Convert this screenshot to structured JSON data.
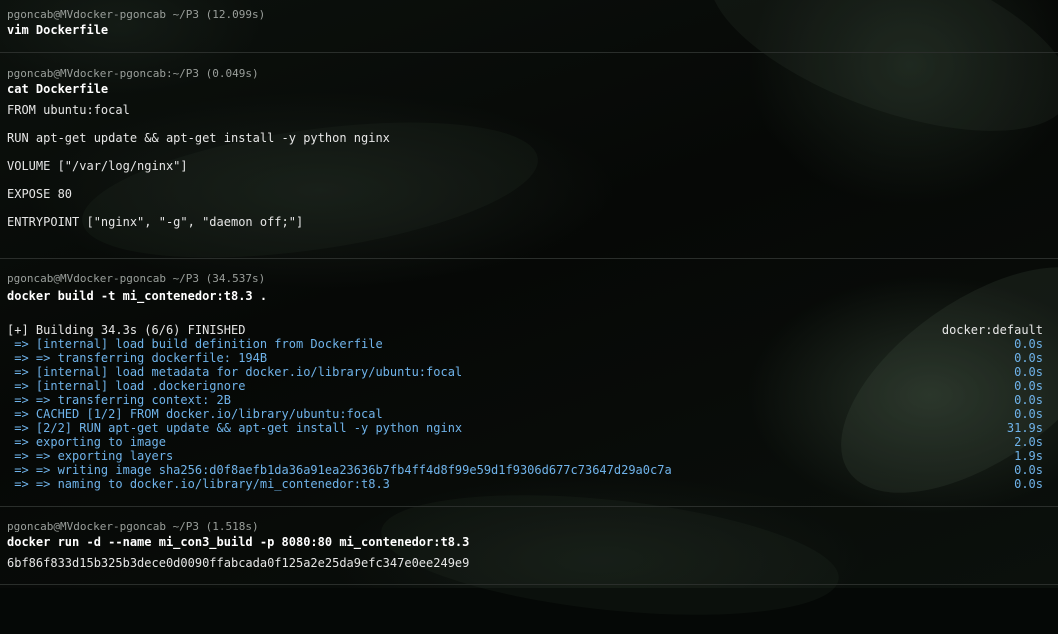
{
  "blocks": [
    {
      "prompt": "pgoncab@MVdocker-pgoncab ~/P3 (12.099s)",
      "command": "vim Dockerfile"
    },
    {
      "prompt": "pgoncab@MVdocker-pgoncab:~/P3 (0.049s)",
      "command": "cat Dockerfile",
      "output": [
        "FROM ubuntu:focal",
        "RUN apt-get update && apt-get install -y python nginx",
        "VOLUME [\"/var/log/nginx\"]",
        "EXPOSE 80",
        "ENTRYPOINT [\"nginx\", \"-g\", \"daemon off;\"]"
      ]
    },
    {
      "prompt": "pgoncab@MVdocker-pgoncab ~/P3 (34.537s)",
      "command": "docker build -t mi_contenedor:t8.3 .",
      "build_header": "[+] Building 34.3s (6/6) FINISHED",
      "build_builder": "docker:default",
      "build_steps": [
        {
          "text": " => [internal] load build definition from Dockerfile",
          "time": "0.0s"
        },
        {
          "text": " => => transferring dockerfile: 194B",
          "time": "0.0s"
        },
        {
          "text": " => [internal] load metadata for docker.io/library/ubuntu:focal",
          "time": "0.0s"
        },
        {
          "text": " => [internal] load .dockerignore",
          "time": "0.0s"
        },
        {
          "text": " => => transferring context: 2B",
          "time": "0.0s"
        },
        {
          "text": " => CACHED [1/2] FROM docker.io/library/ubuntu:focal",
          "time": "0.0s"
        },
        {
          "text": " => [2/2] RUN apt-get update && apt-get install -y python nginx",
          "time": "31.9s"
        },
        {
          "text": " => exporting to image",
          "time": "2.0s"
        },
        {
          "text": " => => exporting layers",
          "time": "1.9s"
        },
        {
          "text": " => => writing image sha256:d0f8aefb1da36a91ea23636b7fb4ff4d8f99e59d1f9306d677c73647d29a0c7a",
          "time": "0.0s"
        },
        {
          "text": " => => naming to docker.io/library/mi_contenedor:t8.3",
          "time": "0.0s"
        }
      ]
    },
    {
      "prompt": "pgoncab@MVdocker-pgoncab ~/P3 (1.518s)",
      "command": "docker run -d --name mi_con3_build -p 8080:80 mi_contenedor:t8.3",
      "output": [
        "6bf86f833d15b325b3dece0d0090ffabcada0f125a2e25da9efc347e0ee249e9"
      ]
    }
  ],
  "colors": {
    "build_output": "#6fb3ea",
    "prompt": "#9a9f9b",
    "command": "#ffffff",
    "divider": "#2a2e2b"
  }
}
